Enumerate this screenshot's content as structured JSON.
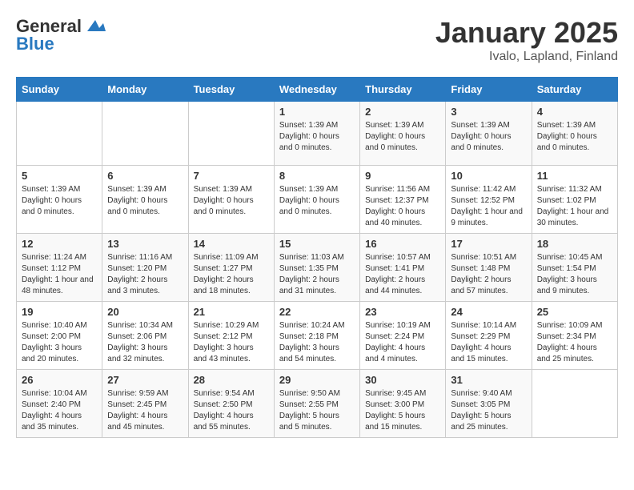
{
  "header": {
    "logo_line1": "General",
    "logo_line2": "Blue",
    "title": "January 2025",
    "subtitle": "Ivalo, Lapland, Finland"
  },
  "weekdays": [
    "Sunday",
    "Monday",
    "Tuesday",
    "Wednesday",
    "Thursday",
    "Friday",
    "Saturday"
  ],
  "weeks": [
    [
      {
        "day": "",
        "info": ""
      },
      {
        "day": "",
        "info": ""
      },
      {
        "day": "",
        "info": ""
      },
      {
        "day": "1",
        "info": "Sunset: 1:39 AM\nDaylight: 0 hours and 0 minutes."
      },
      {
        "day": "2",
        "info": "Sunset: 1:39 AM\nDaylight: 0 hours and 0 minutes."
      },
      {
        "day": "3",
        "info": "Sunset: 1:39 AM\nDaylight: 0 hours and 0 minutes."
      },
      {
        "day": "4",
        "info": "Sunset: 1:39 AM\nDaylight: 0 hours and 0 minutes."
      }
    ],
    [
      {
        "day": "5",
        "info": "Sunset: 1:39 AM\nDaylight: 0 hours and 0 minutes."
      },
      {
        "day": "6",
        "info": "Sunset: 1:39 AM\nDaylight: 0 hours and 0 minutes."
      },
      {
        "day": "7",
        "info": "Sunset: 1:39 AM\nDaylight: 0 hours and 0 minutes."
      },
      {
        "day": "8",
        "info": "Sunset: 1:39 AM\nDaylight: 0 hours and 0 minutes."
      },
      {
        "day": "9",
        "info": "Sunrise: 11:56 AM\nSunset: 12:37 PM\nDaylight: 0 hours and 40 minutes."
      },
      {
        "day": "10",
        "info": "Sunrise: 11:42 AM\nSunset: 12:52 PM\nDaylight: 1 hour and 9 minutes."
      },
      {
        "day": "11",
        "info": "Sunrise: 11:32 AM\nSunset: 1:02 PM\nDaylight: 1 hour and 30 minutes."
      }
    ],
    [
      {
        "day": "12",
        "info": "Sunrise: 11:24 AM\nSunset: 1:12 PM\nDaylight: 1 hour and 48 minutes."
      },
      {
        "day": "13",
        "info": "Sunrise: 11:16 AM\nSunset: 1:20 PM\nDaylight: 2 hours and 3 minutes."
      },
      {
        "day": "14",
        "info": "Sunrise: 11:09 AM\nSunset: 1:27 PM\nDaylight: 2 hours and 18 minutes."
      },
      {
        "day": "15",
        "info": "Sunrise: 11:03 AM\nSunset: 1:35 PM\nDaylight: 2 hours and 31 minutes."
      },
      {
        "day": "16",
        "info": "Sunrise: 10:57 AM\nSunset: 1:41 PM\nDaylight: 2 hours and 44 minutes."
      },
      {
        "day": "17",
        "info": "Sunrise: 10:51 AM\nSunset: 1:48 PM\nDaylight: 2 hours and 57 minutes."
      },
      {
        "day": "18",
        "info": "Sunrise: 10:45 AM\nSunset: 1:54 PM\nDaylight: 3 hours and 9 minutes."
      }
    ],
    [
      {
        "day": "19",
        "info": "Sunrise: 10:40 AM\nSunset: 2:00 PM\nDaylight: 3 hours and 20 minutes."
      },
      {
        "day": "20",
        "info": "Sunrise: 10:34 AM\nSunset: 2:06 PM\nDaylight: 3 hours and 32 minutes."
      },
      {
        "day": "21",
        "info": "Sunrise: 10:29 AM\nSunset: 2:12 PM\nDaylight: 3 hours and 43 minutes."
      },
      {
        "day": "22",
        "info": "Sunrise: 10:24 AM\nSunset: 2:18 PM\nDaylight: 3 hours and 54 minutes."
      },
      {
        "day": "23",
        "info": "Sunrise: 10:19 AM\nSunset: 2:24 PM\nDaylight: 4 hours and 4 minutes."
      },
      {
        "day": "24",
        "info": "Sunrise: 10:14 AM\nSunset: 2:29 PM\nDaylight: 4 hours and 15 minutes."
      },
      {
        "day": "25",
        "info": "Sunrise: 10:09 AM\nSunset: 2:34 PM\nDaylight: 4 hours and 25 minutes."
      }
    ],
    [
      {
        "day": "26",
        "info": "Sunrise: 10:04 AM\nSunset: 2:40 PM\nDaylight: 4 hours and 35 minutes."
      },
      {
        "day": "27",
        "info": "Sunrise: 9:59 AM\nSunset: 2:45 PM\nDaylight: 4 hours and 45 minutes."
      },
      {
        "day": "28",
        "info": "Sunrise: 9:54 AM\nSunset: 2:50 PM\nDaylight: 4 hours and 55 minutes."
      },
      {
        "day": "29",
        "info": "Sunrise: 9:50 AM\nSunset: 2:55 PM\nDaylight: 5 hours and 5 minutes."
      },
      {
        "day": "30",
        "info": "Sunrise: 9:45 AM\nSunset: 3:00 PM\nDaylight: 5 hours and 15 minutes."
      },
      {
        "day": "31",
        "info": "Sunrise: 9:40 AM\nSunset: 3:05 PM\nDaylight: 5 hours and 25 minutes."
      },
      {
        "day": "",
        "info": ""
      }
    ]
  ]
}
